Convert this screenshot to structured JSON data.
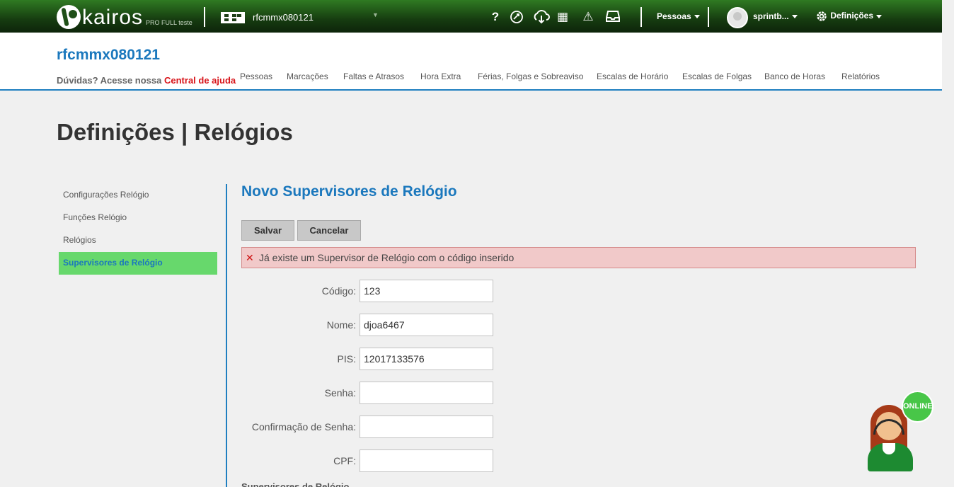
{
  "topbar": {
    "logo_text": "kairos",
    "logo_sub": "PRO FULL teste",
    "company_name": "rfcmmx080121",
    "icons": [
      "help-icon",
      "support-icon",
      "cloud-download-icon",
      "calculator-icon",
      "warning-icon",
      "inbox-icon"
    ],
    "help_glyph": "?",
    "warning_glyph": "⚠",
    "calculator_glyph": "▦",
    "menu_pessoas": "Pessoas",
    "user_name": "sprintb...",
    "menu_definicoes": "Definições"
  },
  "header": {
    "account_title": "rfcmmx080121",
    "help_prefix": "Dúvidas? Acesse nossa",
    "help_link": "Central de ajuda",
    "nav": [
      "Pessoas",
      "Marcações",
      "Faltas e Atrasos",
      "Hora Extra",
      "Férias, Folgas e Sobreaviso",
      "Escalas de Horário",
      "Escalas de Folgas",
      "Banco de Horas",
      "Relatórios"
    ]
  },
  "page_title": "Definições | Relógios",
  "sidebar": {
    "items": [
      "Configurações Relógio",
      "Funções Relógio",
      "Relógios",
      "Supervisores de Relógio"
    ],
    "active_index": 3
  },
  "main": {
    "section_title": "Novo Supervisores de Relógio",
    "save_label": "Salvar",
    "cancel_label": "Cancelar",
    "error_message": "Já existe um Supervisor de Relógio com o código inserido",
    "fields": [
      {
        "label": "Código:",
        "value": "123"
      },
      {
        "label": "Nome:",
        "value": "djoa6467"
      },
      {
        "label": "PIS:",
        "value": "12017133576"
      },
      {
        "label": "Senha:",
        "value": ""
      },
      {
        "label": "Confirmação de Senha:",
        "value": ""
      },
      {
        "label": "CPF:",
        "value": ""
      }
    ],
    "subsection": "Supervisores de Relógio"
  },
  "chat": {
    "status": "ONLINE"
  },
  "colors": {
    "brand_green": "#1e4f17",
    "accent_blue": "#1b78bd",
    "active_green": "#67d86c",
    "error_bg": "#f1c9c9"
  }
}
